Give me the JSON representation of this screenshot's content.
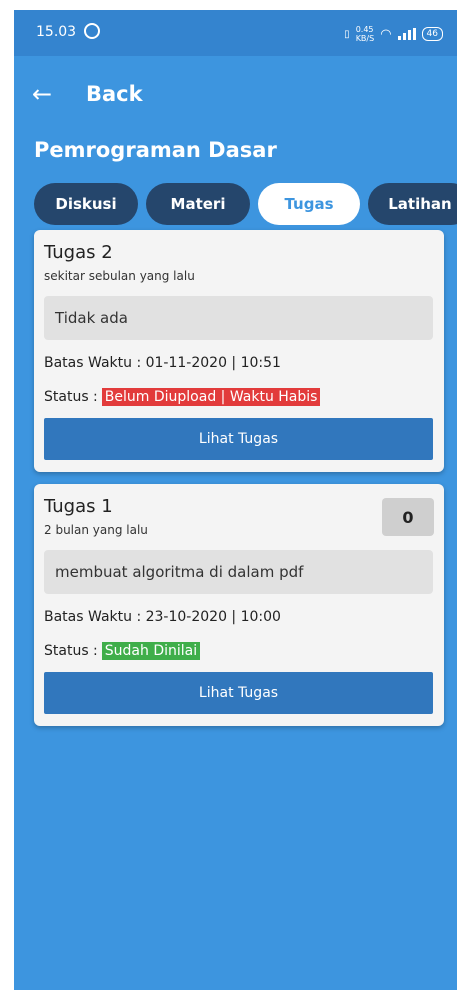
{
  "status_bar": {
    "time": "15.03",
    "net_speed": "0.45",
    "net_unit": "KB/S",
    "battery": "46"
  },
  "header": {
    "back_label": "Back"
  },
  "page_title": "Pemrograman Dasar",
  "tabs": [
    {
      "label": "Diskusi",
      "active": false
    },
    {
      "label": "Materi",
      "active": false
    },
    {
      "label": "Tugas",
      "active": true
    },
    {
      "label": "Latihan",
      "active": false
    }
  ],
  "assignments": [
    {
      "title": "Tugas 2",
      "time_ago": "sekitar sebulan yang lalu",
      "description": "Tidak ada",
      "deadline": "Batas Waktu : 01-11-2020 | 10:51",
      "status_label": "Status :",
      "status": "Belum Diupload | Waktu Habis",
      "status_color": "#e23b3b",
      "button": "Lihat Tugas"
    },
    {
      "title": "Tugas 1",
      "time_ago": "2 bulan yang lalu",
      "score": "0",
      "description": "membuat algoritma di dalam pdf",
      "deadline": "Batas Waktu : 23-10-2020 | 10:00",
      "status_label": "Status :",
      "status": "Sudah Dinilai",
      "status_color": "#3fae4a",
      "button": "Lihat Tugas"
    }
  ],
  "colors": {
    "background": "#3d95df",
    "status_bar": "#3484cf",
    "tab_inactive": "#25466c",
    "button": "#3177bd"
  }
}
